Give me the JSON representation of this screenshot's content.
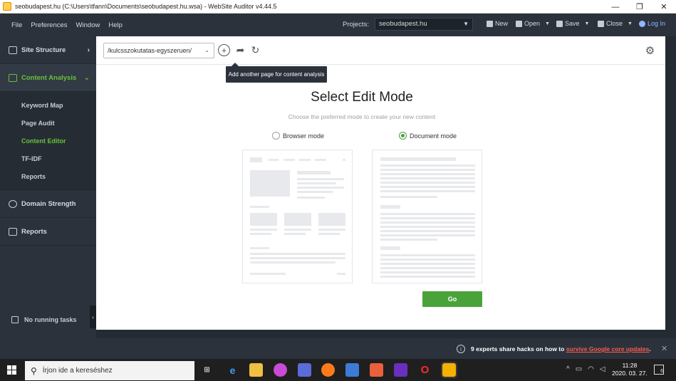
{
  "window": {
    "title": "seobudapest.hu (C:\\Users\\tfann\\Documents\\seobudapest.hu.wsa) - WebSite Auditor v4.44.5",
    "controls": [
      "—",
      "❐",
      "✕"
    ]
  },
  "menu": {
    "items": [
      "File",
      "Preferences",
      "Window",
      "Help"
    ],
    "projects_label": "Projects:",
    "project_value": "seobudapest.hu",
    "buttons": [
      "New",
      "Open",
      "Save",
      "Close",
      "Log In"
    ]
  },
  "sidebar": {
    "sections": [
      {
        "label": "Site Structure"
      },
      {
        "label": "Content Analysis"
      },
      {
        "label": "Domain Strength"
      },
      {
        "label": "Reports"
      }
    ],
    "sub_items": [
      "Keyword Map",
      "Page Audit",
      "Content Editor",
      "TF-IDF",
      "Reports"
    ],
    "tasks": "No running tasks"
  },
  "toolbar": {
    "url": "/kulcsszokutatas-egyszeruen/",
    "tooltip": "Add another page for content analysis"
  },
  "editor": {
    "heading": "Select Edit Mode",
    "subheading": "Choose the preferred mode to create your new content",
    "browser_mode": "Browser mode",
    "document_mode": "Document mode",
    "selected_mode": "Document mode",
    "go": "Go"
  },
  "notification": {
    "prefix": "9 experts share hacks on how to",
    "link": "survive Google core updates",
    "suffix": "."
  },
  "taskbar": {
    "search_placeholder": "Írjon ide a kereséshez",
    "time": "11:28",
    "date": "2020. 03. 27.",
    "notif_count": "6"
  },
  "colors": {
    "accent_green": "#4aa33a",
    "sidebar_bg": "#2b323c",
    "link_red": "#ff5a4e"
  }
}
